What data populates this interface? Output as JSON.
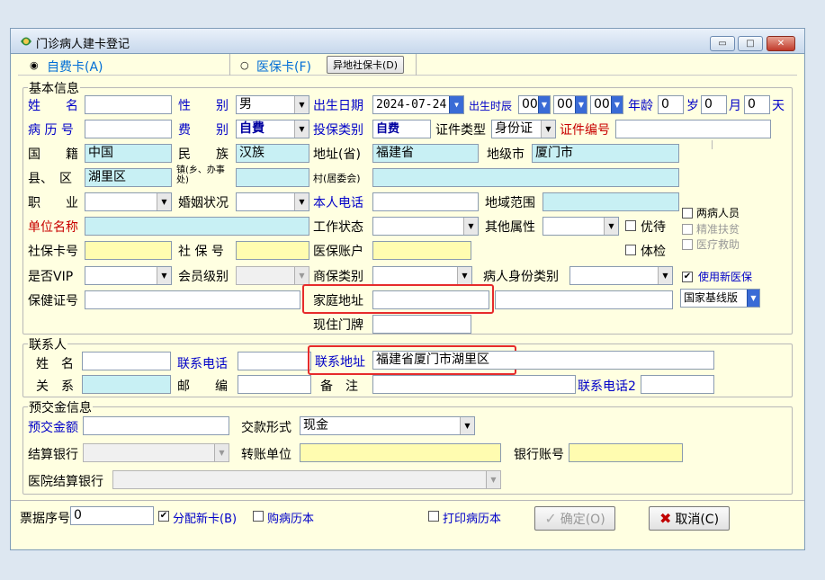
{
  "window": {
    "title": "门诊病人建卡登记"
  },
  "cardtype": {
    "self_label": "自费卡(A)",
    "ins_label": "医保卡(F)",
    "remote_label": "异地社保卡(D)"
  },
  "basic": {
    "title": "基本信息",
    "name_label": "姓　　名",
    "name": "",
    "gender_label": "性　　别",
    "gender": "男",
    "dob_label": "出生日期",
    "dob": "2024-07-24",
    "birthtime_label": "出生时辰",
    "hh": "00",
    "mm": "00",
    "ss": "00",
    "age_label": "年龄",
    "age": "0",
    "sui": "岁",
    "months": "0",
    "yue": "月",
    "days": "0",
    "tian": "天",
    "record_label": "病 历 号",
    "record": "",
    "fee_label": "费　　别",
    "fee": "自費",
    "insure_label": "投保类别",
    "insure": "自费",
    "idtype_label": "证件类型",
    "idtype": "身份证",
    "idno_label": "证件编号",
    "idno": "",
    "nation_label": "国　　籍",
    "nation": "中国",
    "ethnic_label": "民　　族",
    "ethnic": "汉族",
    "province_label": "地址(省)",
    "province": "福建省",
    "city_label": "地级市",
    "city": "厦门市",
    "county_label": "县、　区",
    "county": "湖里区",
    "town_label": "镇(乡、办事处)",
    "town": "",
    "village_label": "村(居委会)",
    "village": "",
    "job_label": "职　　业",
    "job": "",
    "marital_label": "婚姻状况",
    "marital": "",
    "phone_label": "本人电话",
    "phone": "",
    "area_label": "地域范围",
    "area": "",
    "company_label": "单位名称",
    "company": "",
    "work_label": "工作状态",
    "work": "",
    "otherattr_label": "其他属性",
    "otherattr": "",
    "youdai_label": "优待",
    "tijian_label": "体检",
    "sscard_label": "社保卡号",
    "sscard": "",
    "ssno_label": "社 保 号",
    "ssno": "",
    "insacct_label": "医保账户",
    "insacct": "",
    "vip_label": "是否VIP",
    "vip": "",
    "member_label": "会员级别",
    "member": "",
    "cominsure_label": "商保类别",
    "cominsure": "",
    "identity_label": "病人身份类别",
    "identity": "",
    "health_label": "保健证号",
    "health": "",
    "home_label": "家庭地址",
    "home": "",
    "home2": "",
    "door_label": "现住门牌",
    "door": ""
  },
  "side": {
    "liangbing": "两病人员",
    "jingzhun": "精准扶贫",
    "yiliao": "医疗救助",
    "newins": "使用新医保",
    "version": "国家基线版"
  },
  "contact": {
    "title": "联系人",
    "name_label": "姓　名",
    "name": "",
    "phone_label": "联系电话",
    "phone": "",
    "addr_label": "联系地址",
    "addr": "福建省厦门市湖里区",
    "rel_label": "关　系",
    "rel": "",
    "zip_label": "邮　　编",
    "zip": "",
    "note_label": "备　注",
    "note": "",
    "phone2_label": "联系电话2",
    "phone2": ""
  },
  "deposit": {
    "title": "预交金信息",
    "amount_label": "预交金额",
    "amount": "",
    "paytype_label": "交款形式",
    "paytype": "现金",
    "bank_label": "结算银行",
    "bank": "",
    "transfer_label": "转账单位",
    "transfer": "",
    "acct_label": "银行账号",
    "acct": "",
    "hospbank_label": "医院结算银行",
    "hospbank": ""
  },
  "bottom": {
    "ticket_label": "票据序号",
    "ticket": "0",
    "newcard": "分配新卡(B)",
    "buy": "购病历本",
    "print": "打印病历本",
    "ok": "确定(O)",
    "cancel": "取消(C)"
  },
  "colors": {
    "accent_blue": "#0000c8",
    "accent_red": "#c80000",
    "highlight": "#e62b2b",
    "panel": "#ffffe1"
  }
}
